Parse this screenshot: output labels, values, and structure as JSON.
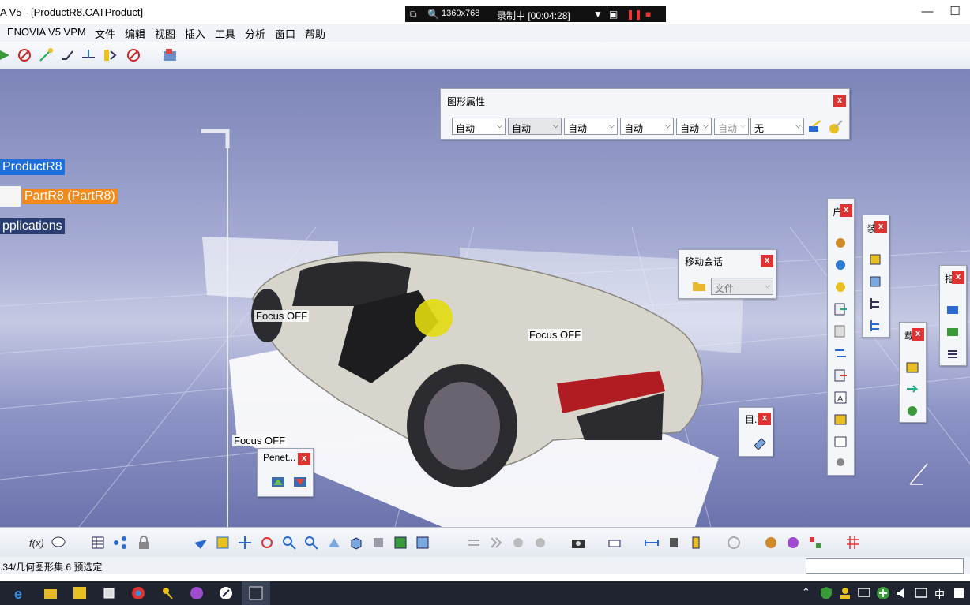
{
  "window": {
    "title": "A V5 - [ProductR8.CATProduct]"
  },
  "recorder": {
    "size": "1360x768",
    "status": "录制中 [00:04:28]"
  },
  "menu": [
    "ENOVIA V5 VPM",
    "文件",
    "编辑",
    "视图",
    "插入",
    "工具",
    "分析",
    "窗口",
    "帮助"
  ],
  "tree": {
    "root": "ProductR8",
    "part": "PartR8 (PartR8)",
    "apps": "pplications"
  },
  "graphic_props": {
    "title": "图形属性",
    "combos": [
      "自动",
      "自动",
      "自动",
      "自动",
      "自动",
      "自动",
      "无"
    ]
  },
  "move_session": {
    "title": "移动会话",
    "combo": "文件"
  },
  "focus_labels": [
    "Focus OFF",
    "Focus OFF",
    "Focus OFF"
  ],
  "penet": {
    "title": "Penet..."
  },
  "target": {
    "title": "目."
  },
  "vtoolbars": {
    "t1": "户",
    "t2": "装",
    "t3": "载",
    "t4": "指"
  },
  "close_glyph": "x",
  "status": {
    "text": ".34/几何图形集.6 预选定"
  },
  "taskbar": {
    "lang": "中"
  },
  "colors": {
    "tree_root_bg": "#1e6fd9",
    "tree_part_bg": "#f08a1c",
    "tree_apps_bg": "#2a3d73",
    "close_btn": "#d33"
  }
}
